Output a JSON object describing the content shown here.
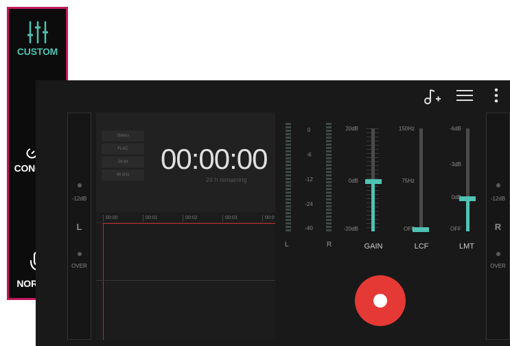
{
  "modes": [
    {
      "label": "CUSTOM",
      "icon": "sliders-icon",
      "active": true
    },
    {
      "label": "CONCERT",
      "icon": "electric-guitar-icon",
      "active": false
    },
    {
      "label": "NORMAL",
      "icon": "microphone-icon",
      "active": false
    }
  ],
  "toolbar": {
    "add_music_icon": "music-note-add-icon",
    "menu_icon": "hamburger-menu-icon",
    "more_icon": "more-vertical-icon"
  },
  "left_meter": {
    "level": "-12dB",
    "channel": "L",
    "over": "OVER"
  },
  "right_meter": {
    "level": "-12dB",
    "channel": "R",
    "over": "OVER"
  },
  "info": {
    "formats": [
      "Stereo",
      "FLAC",
      "24 bit",
      "48 kHz"
    ],
    "timer": "00:00:00",
    "remaining": "24 h remaining"
  },
  "timeline": {
    "ticks": [
      "00:00",
      "00:01",
      "00:02",
      "00:03",
      "00:0"
    ]
  },
  "vu": {
    "scale": [
      "0",
      "-6",
      "-12",
      "-24",
      "-40"
    ],
    "left": "L",
    "right": "R"
  },
  "faders": {
    "gain": {
      "name": "GAIN",
      "top": "20dB",
      "mid": "0dB",
      "bottom": "-20dB",
      "level": 0.5
    },
    "lcf": {
      "name": "LCF",
      "top": "150Hz",
      "mid": "75Hz",
      "bottom": "OFF",
      "level": 0.0
    },
    "lmt": {
      "name": "LMT",
      "top": "-6dB",
      "mid": "-3dB",
      "mid2": "0dB",
      "bottom": "OFF",
      "level": 0.33
    }
  },
  "colors": {
    "accent": "#4fc3b3",
    "record": "#e53935",
    "frame": "#c2185b"
  }
}
